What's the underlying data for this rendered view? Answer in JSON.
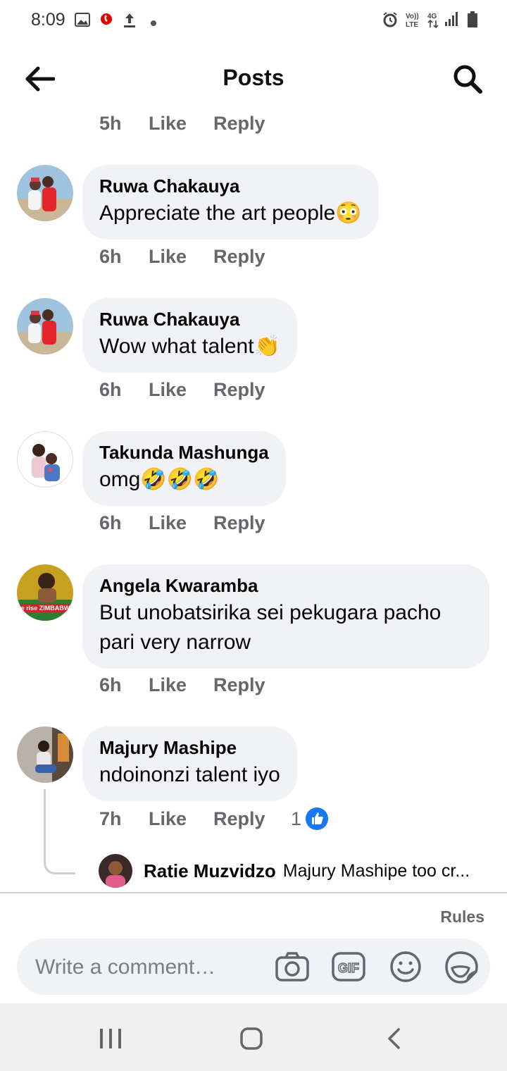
{
  "status_bar": {
    "time": "8:09",
    "icons": [
      "gallery-icon",
      "vodafone-icon",
      "upload-icon",
      "dot-icon",
      "alarm-icon",
      "volte-icon",
      "4g-icon",
      "signal-icon",
      "battery-icon"
    ],
    "volte_label": "Vo))\nLTE",
    "network_label": "4G"
  },
  "header": {
    "title": "Posts",
    "back_icon": "arrow-left-icon",
    "search_icon": "search-icon"
  },
  "top_meta": {
    "time": "5h",
    "like": "Like",
    "reply": "Reply"
  },
  "comments": [
    {
      "name": "Ruwa Chakauya",
      "text": "Appreciate the art people😳",
      "time": "6h",
      "like": "Like",
      "reply": "Reply"
    },
    {
      "name": "Ruwa Chakauya",
      "text": "Wow what talent👏",
      "time": "6h",
      "like": "Like",
      "reply": "Reply"
    },
    {
      "name": "Takunda Mashunga",
      "text": "omg🤣🤣🤣",
      "time": "6h",
      "like": "Like",
      "reply": "Reply"
    },
    {
      "name": "Angela Kwaramba",
      "text": "But unobatsirika sei pekugara pacho pari very narrow",
      "time": "6h",
      "like": "Like",
      "reply": "Reply",
      "avatar_text": "we rise ZIMBABWE"
    },
    {
      "name": "Majury Mashipe",
      "text": "ndoinonzi talent iyo",
      "time": "7h",
      "like": "Like",
      "reply": "Reply",
      "reaction_count": "1"
    }
  ],
  "sub_reply": {
    "name": "Ratie Muzvidzo",
    "text": "Majury Mashipe too  cr..."
  },
  "rules_label": "Rules",
  "composer": {
    "placeholder": "Write a comment…",
    "icons": [
      "camera-icon",
      "gif-icon",
      "emoji-icon",
      "sticker-icon"
    ],
    "gif_label": "GIF"
  },
  "nav": {
    "icons": [
      "recent-apps-icon",
      "home-icon",
      "back-icon"
    ]
  },
  "colors": {
    "bubble": "#f0f2f5",
    "meta": "#65676b",
    "like_blue": "#1877f2"
  }
}
